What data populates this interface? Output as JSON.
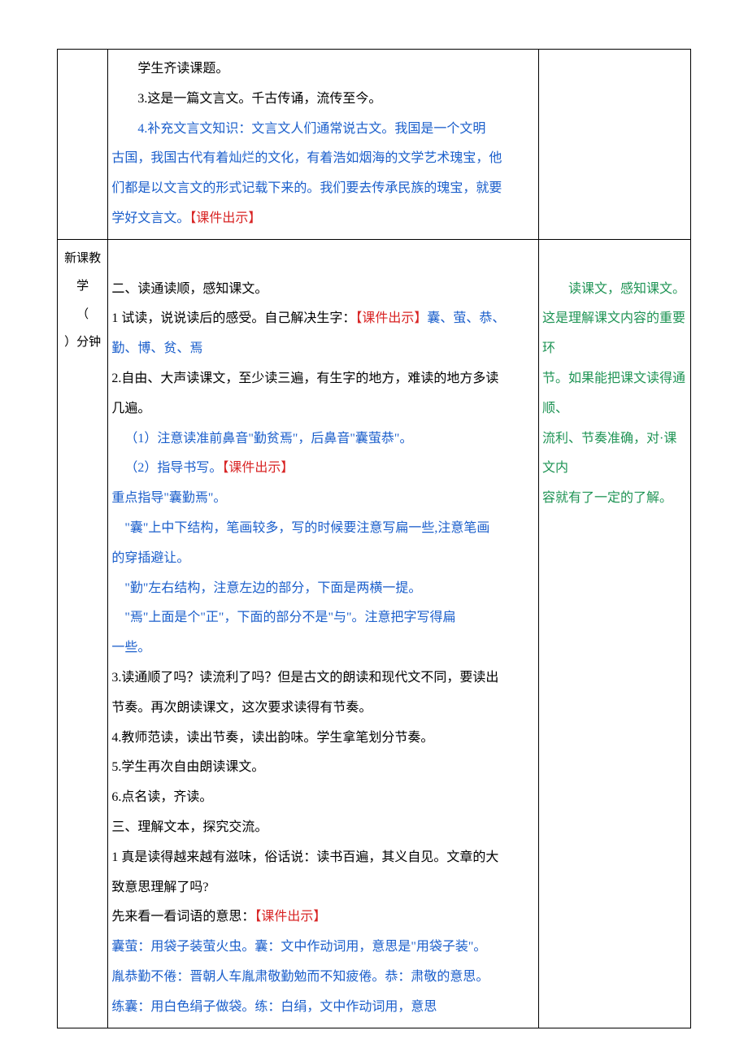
{
  "row1": {
    "main": {
      "l1": "学生齐读课题。",
      "l2": "3.这是一篇文言文。千古传诵，流传至今。",
      "l3a": "4.补充文言文知识：文言文人们通常说古文。我国是一个文明",
      "l3b": "古国，我国古代有着灿烂的文化，有着浩如烟海的文学艺术瑰宝，他",
      "l3c": "们都是以文言文的形式记载下来的。我们要去传承民族的瑰宝，就要",
      "l3d": "学好文言文。",
      "tag": "【课件出示】"
    }
  },
  "row2": {
    "label_a": "新课教学",
    "label_b": "（",
    "label_c": "）分钟",
    "main": {
      "s2_title": "二、读通读顺，感知课文。",
      "s2_1a": "1 试读，说说读后的感受。自己解决生字：",
      "s2_1a_tag": "【课件出示】",
      "s2_1a_end": "囊、萤、恭、",
      "s2_1b": "勤、博、贫、焉",
      "s2_2a": "2.自由、大声读课文，至少读三遍，有生字的地方，难读的地方多读",
      "s2_2b": "几遍。",
      "s2_2_p1": "（1）注意读准前鼻音\"勤贫焉\"，后鼻音\"囊萤恭\"。",
      "s2_2_p2a": "（2）指导书写。",
      "s2_2_p2a_tag": "【课件出示】",
      "s2_key": "重点指导\"囊勤焉\"。",
      "s2_nang_a": "\"囊\"上中下结构，笔画较多，写的时候要注意写扁一些,注意笔画",
      "s2_nang_b": "的穿插避让。",
      "s2_qin": "\"勤\"左右结构，注意左边的部分，下面是两横一提。",
      "s2_yan_a": "\"焉\"上面是个\"正\"，下面的部分不是\"与\"。注意把字写得扁",
      "s2_yan_b": "一些。",
      "s2_3a": "3.读通顺了吗？读流利了吗？但是古文的朗读和现代文不同，要读出",
      "s2_3b": "节奏。再次朗读课文，这次要求读得有节奏。",
      "s2_4": "4.教师范读，读出节奏，读出韵味。学生拿笔划分节奏。",
      "s2_5": "5.学生再次自由朗读课文。",
      "s2_6": "6.点名读，齐读。",
      "s3_title": "三、理解文本，探究交流。",
      "s3_1a": "1 真是读得越来越有滋味，俗话说：读书百遍，其义自见。文章的大",
      "s3_1b": "致意思理解了吗?",
      "s3_2a": "先来看一看词语的意思：",
      "s3_2a_tag": "【课件出示】",
      "s3_w1": "囊萤：用袋子装萤火虫。囊：文中作动词用，意思是\"用袋子装\"。",
      "s3_w2": "胤恭勤不倦：晋朝人车胤肃敬勤勉而不知疲倦。恭：肃敬的意思。",
      "s3_w3": "练囊：用白色绢子做袋。练：白绢，文中作动词用，意思"
    },
    "note": {
      "n1": "读课文，感知课文。",
      "n2a": "这是理解课文内容的重要环",
      "n2b": "节。如果能把课文读得通顺、",
      "n2c": "流利、节奏准确，对·课文内",
      "n2d": "容就有了一定的了解。"
    }
  }
}
